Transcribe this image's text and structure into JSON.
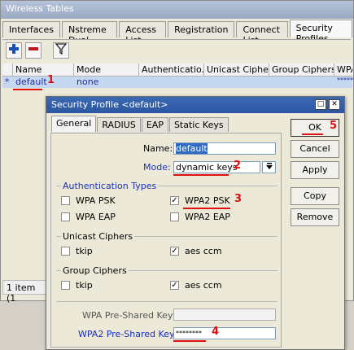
{
  "bg_window": {
    "title": "Wireless Tables",
    "tabs": [
      "Interfaces",
      "Nstreme Dual",
      "Access List",
      "Registration",
      "Connect List",
      "Security Profiles"
    ],
    "active_tab": "Security Profiles",
    "table": {
      "headers": [
        "Name",
        "Mode",
        "Authenticatio...",
        "Unicast Ciphers",
        "Group Ciphers",
        "WPA"
      ],
      "row": {
        "marker": "*",
        "name": "default",
        "mode": "none",
        "wpa": "*******"
      }
    },
    "status": "1 item (1"
  },
  "dialog": {
    "title": "Security Profile <default>",
    "tabs": [
      "General",
      "RADIUS",
      "EAP",
      "Static Keys"
    ],
    "active_tab": "General",
    "name_label": "Name:",
    "name_value": "default",
    "mode_label": "Mode:",
    "mode_value": "dynamic keys",
    "auth_group": "Authentication Types",
    "wpa_psk": "WPA PSK",
    "wpa2_psk": "WPA2 PSK",
    "wpa_eap": "WPA EAP",
    "wpa2_eap": "WPA2 EAP",
    "unicast_group": "Unicast Ciphers",
    "group_group": "Group Ciphers",
    "tkip": "tkip",
    "aes": "aes ccm",
    "wpa_key_label": "WPA Pre-Shared Key:",
    "wpa2_key_label": "WPA2 Pre-Shared Key:",
    "wpa2_key_value": "********",
    "buttons": {
      "ok": "OK",
      "cancel": "Cancel",
      "apply": "Apply",
      "copy": "Copy",
      "remove": "Remove"
    }
  },
  "annotations": [
    "1",
    "2",
    "3",
    "4",
    "5"
  ]
}
